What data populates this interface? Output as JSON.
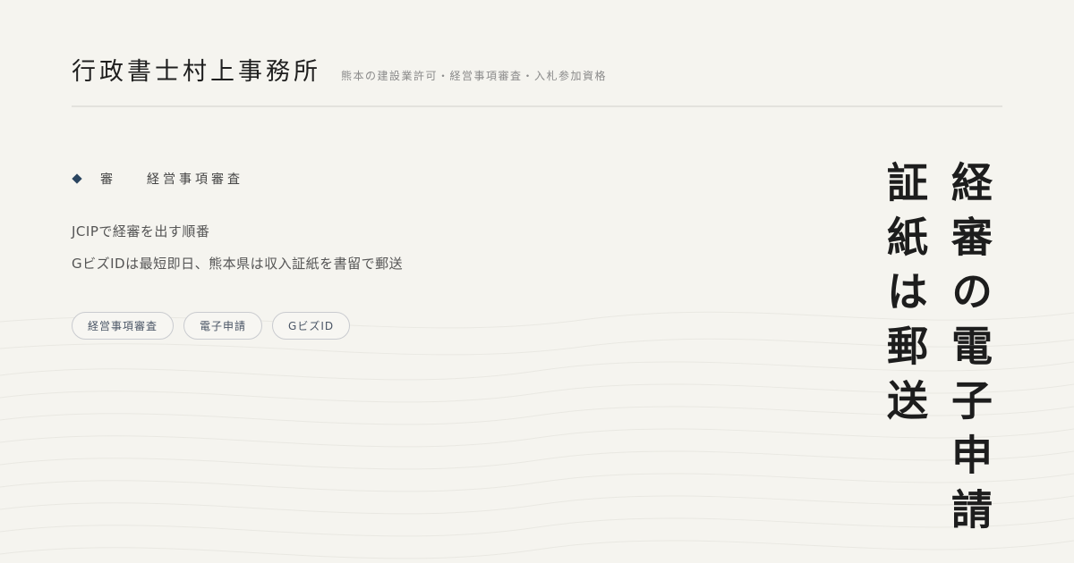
{
  "header": {
    "site_title": "行政書士村上事務所",
    "tagline": "熊本の建設業許可・経営事項審査・入札参加資格"
  },
  "category": {
    "short": "審",
    "label": "経営事項審査"
  },
  "summary": {
    "lines": [
      "JCIPで経審を出す順番",
      "GビズIDは最短即日、熊本県は収入証紙を書留で郵送"
    ]
  },
  "tags": [
    "経営事項審査",
    "電子申請",
    "GビズID"
  ],
  "headline": {
    "column_1": "経審の電子申請",
    "column_2": "証紙は郵送"
  },
  "colors": {
    "background": "#f5f4ef",
    "accent": "#2a4560",
    "divider": "#e3e2dd"
  },
  "icons": {
    "bullet": "diamond-icon"
  }
}
